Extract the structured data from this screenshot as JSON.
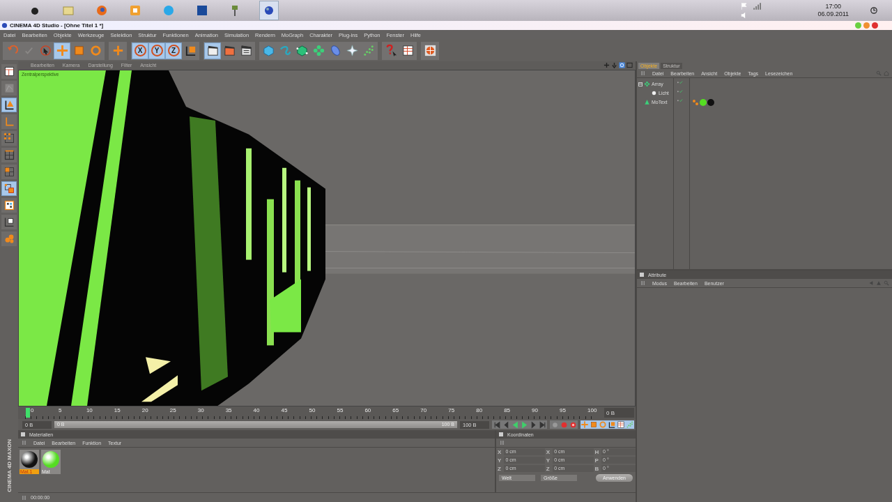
{
  "taskbar": {
    "apps": [
      {
        "kind": "logo",
        "selected": false
      },
      {
        "kind": "folder",
        "selected": false
      },
      {
        "kind": "browser",
        "selected": false
      },
      {
        "kind": "box",
        "selected": false
      },
      {
        "kind": "chat",
        "selected": false
      },
      {
        "kind": "photo",
        "selected": false
      },
      {
        "kind": "tool",
        "selected": false
      },
      {
        "kind": "sphere",
        "selected": true
      }
    ],
    "time": "17:00",
    "date": "06.09.2011"
  },
  "window": {
    "title": "CINEMA 4D Studio - [Ohne Titel 1 *]"
  },
  "menu": [
    "Datei",
    "Bearbeiten",
    "Objekte",
    "Werkzeuge",
    "Selektion",
    "Struktur",
    "Funktionen",
    "Animation",
    "Simulation",
    "Rendern",
    "MoGraph",
    "Charakter",
    "Plug-ins",
    "Python",
    "Fenster",
    "Hilfe"
  ],
  "toolbar": [
    [
      {
        "kind": "undo",
        "selected": false
      },
      {
        "kind": "redo",
        "selected": false
      },
      {
        "kind": "select",
        "selected": false
      },
      {
        "kind": "move",
        "selected": true
      },
      {
        "kind": "scale",
        "selected": false
      },
      {
        "kind": "rotate",
        "selected": false
      }
    ],
    [
      {
        "kind": "add",
        "selected": false
      }
    ],
    [
      {
        "kind": "axis",
        "label": "X",
        "selected": true
      },
      {
        "kind": "axis",
        "label": "Y",
        "selected": true
      },
      {
        "kind": "axis",
        "label": "Z",
        "selected": true
      },
      {
        "kind": "coords",
        "selected": false
      }
    ],
    [
      {
        "kind": "render-view",
        "selected": true
      },
      {
        "kind": "render",
        "selected": false
      },
      {
        "kind": "render-settings",
        "selected": false
      }
    ],
    [
      {
        "kind": "cube",
        "selected": false
      },
      {
        "kind": "spline",
        "selected": false
      },
      {
        "kind": "nurbs",
        "selected": false
      },
      {
        "kind": "array",
        "selected": false
      },
      {
        "kind": "deformer",
        "selected": false
      },
      {
        "kind": "scene",
        "selected": false
      },
      {
        "kind": "particles",
        "selected": false
      }
    ],
    [
      {
        "kind": "help",
        "selected": false
      },
      {
        "kind": "layout",
        "selected": false
      }
    ],
    [
      {
        "kind": "web",
        "selected": false
      }
    ]
  ],
  "side_tools": [
    {
      "kind": "layout",
      "selected": false
    },
    {
      "kind": "sculpt",
      "selected": false
    },
    {
      "kind": "model",
      "selected": true
    },
    {
      "kind": "axis",
      "selected": false
    },
    {
      "kind": "points",
      "selected": false
    },
    {
      "kind": "edges",
      "selected": false
    },
    {
      "kind": "polygons",
      "selected": false
    },
    {
      "kind": "uv",
      "selected": true
    },
    {
      "kind": "texture",
      "selected": false
    },
    {
      "kind": "workplane",
      "selected": false
    },
    {
      "kind": "paint",
      "selected": false
    }
  ],
  "viewport": {
    "menu": [
      "Bearbeiten",
      "Kamera",
      "Darstellung",
      "Filter",
      "Ansicht"
    ],
    "camera": "Zentralperspektive"
  },
  "objects": {
    "tabs": [
      {
        "label": "Objekte",
        "selected": true
      },
      {
        "label": "Struktur",
        "selected": false
      }
    ],
    "menu": [
      "Datei",
      "Bearbeiten",
      "Ansicht",
      "Objekte",
      "Tags",
      "Lesezeichen"
    ],
    "tree": [
      {
        "name": "Array",
        "kind": "array",
        "expanded": true,
        "children": [
          {
            "name": "Licht",
            "kind": "light"
          }
        ]
      },
      {
        "name": "MoText",
        "kind": "text",
        "tags": [
          {
            "kind": "phong"
          },
          {
            "kind": "material",
            "color": "#55dd22"
          },
          {
            "kind": "material",
            "color": "#111111"
          }
        ]
      }
    ]
  },
  "attributes": {
    "title": "Attribute",
    "menu": [
      "Modus",
      "Bearbeiten",
      "Benutzer"
    ]
  },
  "timeline": {
    "labels": [
      "0",
      "5",
      "10",
      "15",
      "20",
      "25",
      "30",
      "35",
      "40",
      "45",
      "50",
      "55",
      "60",
      "65",
      "70",
      "75",
      "80",
      "85",
      "90",
      "95",
      "100"
    ],
    "level": 0,
    "frame": "0 B",
    "start": "0 B",
    "range": {
      "start": "0 B",
      "end": "100 B",
      "level": 1
    },
    "end": "100 B"
  },
  "materials": {
    "title": "Materialien",
    "menu": [
      "Datei",
      "Bearbeiten",
      "Funktion",
      "Textur"
    ],
    "items": [
      {
        "name": "Mat.1",
        "color": "#111111",
        "selected": true
      },
      {
        "name": "Mat",
        "color": "#55dd22",
        "selected": false
      }
    ]
  },
  "coordinates": {
    "title": "Koordinaten",
    "rows": [
      {
        "axis": "X",
        "position": "0 cm",
        "size_axis": "X",
        "size": "0 cm",
        "rot_axis": "H",
        "rotation": "0 °"
      },
      {
        "axis": "Y",
        "position": "0 cm",
        "size_axis": "Y",
        "size": "0 cm",
        "rot_axis": "P",
        "rotation": "0 °"
      },
      {
        "axis": "Z",
        "position": "0 cm",
        "size_axis": "Z",
        "size": "0 cm",
        "rot_axis": "B",
        "rotation": "0 °"
      }
    ],
    "modes": [
      "Welt",
      "Größe"
    ],
    "apply": "Anwenden"
  },
  "status": {
    "time": "00:00:00"
  },
  "logo": {
    "line_1": "MAXON",
    "line_2": "CINEMA 4D"
  }
}
